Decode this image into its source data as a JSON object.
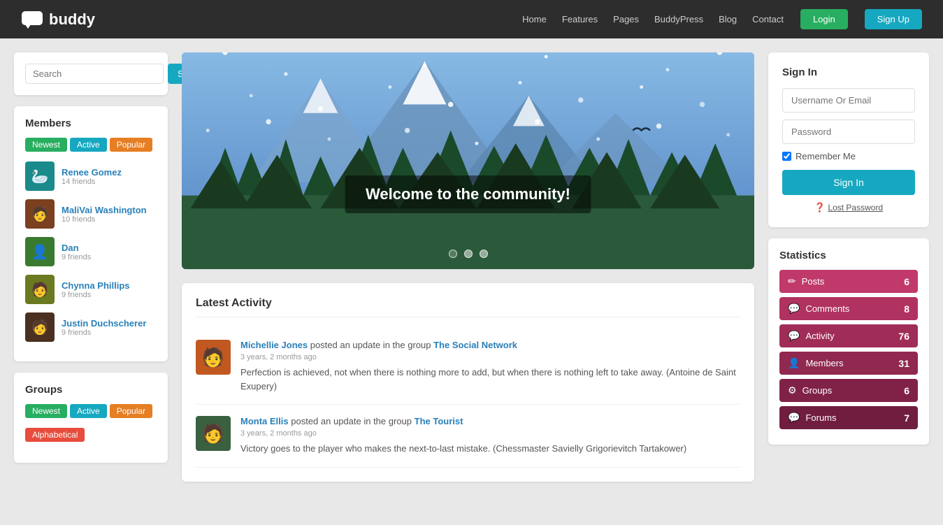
{
  "header": {
    "logo_text": "buddy",
    "nav": {
      "home": "Home",
      "features": "Features",
      "pages": "Pages",
      "buddypress": "BuddyPress",
      "blog": "Blog",
      "contact": "Contact"
    },
    "login_label": "Login",
    "signup_label": "Sign Up"
  },
  "search": {
    "placeholder": "Search",
    "button_label": "Search"
  },
  "members_section": {
    "title": "Members",
    "tabs": [
      "Newest",
      "Active",
      "Popular"
    ],
    "members": [
      {
        "name": "Renee Gomez",
        "friends": "14 friends",
        "avatar_color": "#1a8a8a",
        "emoji": "🦢"
      },
      {
        "name": "MaliVai Washington",
        "friends": "10 friends",
        "avatar_color": "#7a4020",
        "emoji": "🧑"
      },
      {
        "name": "Dan",
        "friends": "9 friends",
        "avatar_color": "#3a7a30",
        "emoji": "👤"
      },
      {
        "name": "Chynna Phillips",
        "friends": "9 friends",
        "avatar_color": "#6a7a20",
        "emoji": "🧑"
      },
      {
        "name": "Justin Duchscherer",
        "friends": "9 friends",
        "avatar_color": "#4a3020",
        "emoji": "🧑"
      }
    ]
  },
  "groups_section": {
    "title": "Groups",
    "tabs": [
      "Newest",
      "Active",
      "Popular",
      "Alphabetical"
    ]
  },
  "hero": {
    "welcome_text": "Welcome to the community!",
    "dots": 3,
    "active_dot": 0
  },
  "activity": {
    "title": "Latest Activity",
    "items": [
      {
        "user": "Michellie Jones",
        "action": "posted an update in the group",
        "group": "The Social Network",
        "time": "3 years, 2 months ago",
        "text": "Perfection is achieved, not when there is nothing more to add, but when there is nothing left to take away. (Antoine de Saint Exupery)",
        "avatar_color": "#c0580a",
        "emoji": "🧑"
      },
      {
        "user": "Monta Ellis",
        "action": "posted an update in the group",
        "group": "The Tourist",
        "time": "3 years, 2 months ago",
        "text": "Victory goes to the player who makes the next-to-last mistake. (Chessmaster Savielly Grigorievitch Tartakower)",
        "avatar_color": "#3a6040",
        "emoji": "🧑"
      }
    ]
  },
  "signin": {
    "title": "Sign In",
    "username_placeholder": "Username Or Email",
    "password_placeholder": "Password",
    "remember_label": "Remember Me",
    "signin_button": "Sign In",
    "lost_password": "Lost Password"
  },
  "statistics": {
    "title": "Statistics",
    "stats": [
      {
        "label": "Posts",
        "count": "6",
        "icon": "✏"
      },
      {
        "label": "Comments",
        "count": "8",
        "icon": "💬"
      },
      {
        "label": "Activity",
        "count": "76",
        "icon": "💬"
      },
      {
        "label": "Members",
        "count": "31",
        "icon": "👤"
      },
      {
        "label": "Groups",
        "count": "6",
        "icon": "⚙"
      },
      {
        "label": "Forums",
        "count": "7",
        "icon": "💬"
      }
    ]
  }
}
